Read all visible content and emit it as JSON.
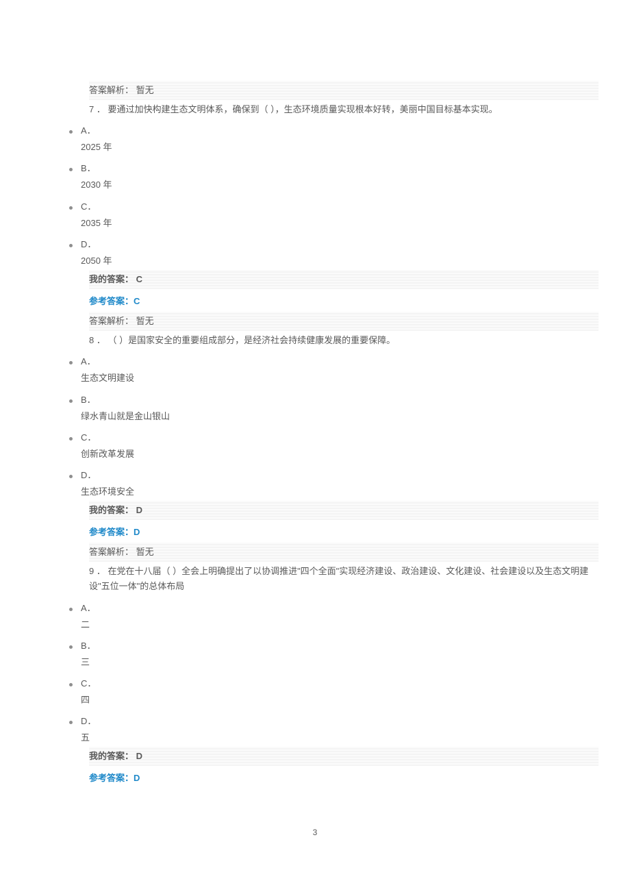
{
  "top_explanation": "答案解析： 暂无",
  "questions": [
    {
      "num": "7 ．",
      "stem": " 要通过加快构建生态文明体系，确保到（ ），生态环境质量实现根本好转，美丽中国目标基本实现。",
      "options": [
        {
          "letter": "A．",
          "text": "2025 年"
        },
        {
          "letter": "B．",
          "text": "2030 年"
        },
        {
          "letter": "C．",
          "text": "2035 年"
        },
        {
          "letter": "D．",
          "text": "2050 年"
        }
      ],
      "my_answer_label": "我的答案：",
      "my_answer_letter": " C",
      "ref_answer": "参考答案：C",
      "explanation": "答案解析： 暂无"
    },
    {
      "num": "8 ．",
      "stem": " （ ）是国家安全的重要组成部分，是经济社会持续健康发展的重要保障。",
      "options": [
        {
          "letter": "A．",
          "text": " 生态文明建设"
        },
        {
          "letter": "B．",
          "text": "绿水青山就是金山银山"
        },
        {
          "letter": "C．",
          "text": "创新改革发展"
        },
        {
          "letter": "D．",
          "text": "生态环境安全"
        }
      ],
      "my_answer_label": "我的答案：",
      "my_answer_letter": " D",
      "ref_answer": "参考答案：D",
      "explanation": "答案解析： 暂无"
    },
    {
      "num": "9 ．",
      "stem": " 在党在十八届（ ）全会上明确提出了以协调推进\"四个全面\"实现经济建设、政治建设、文化建设、社会建设以及生态文明建设\"五位一体\"的总体布局",
      "options": [
        {
          "letter": "A．",
          "text": "二"
        },
        {
          "letter": "B．",
          "text": "三"
        },
        {
          "letter": "C．",
          "text": "四"
        },
        {
          "letter": "D．",
          "text": "五"
        }
      ],
      "my_answer_label": "我的答案：",
      "my_answer_letter": " D",
      "ref_answer": "参考答案：D",
      "explanation": ""
    }
  ],
  "page_number": "3"
}
